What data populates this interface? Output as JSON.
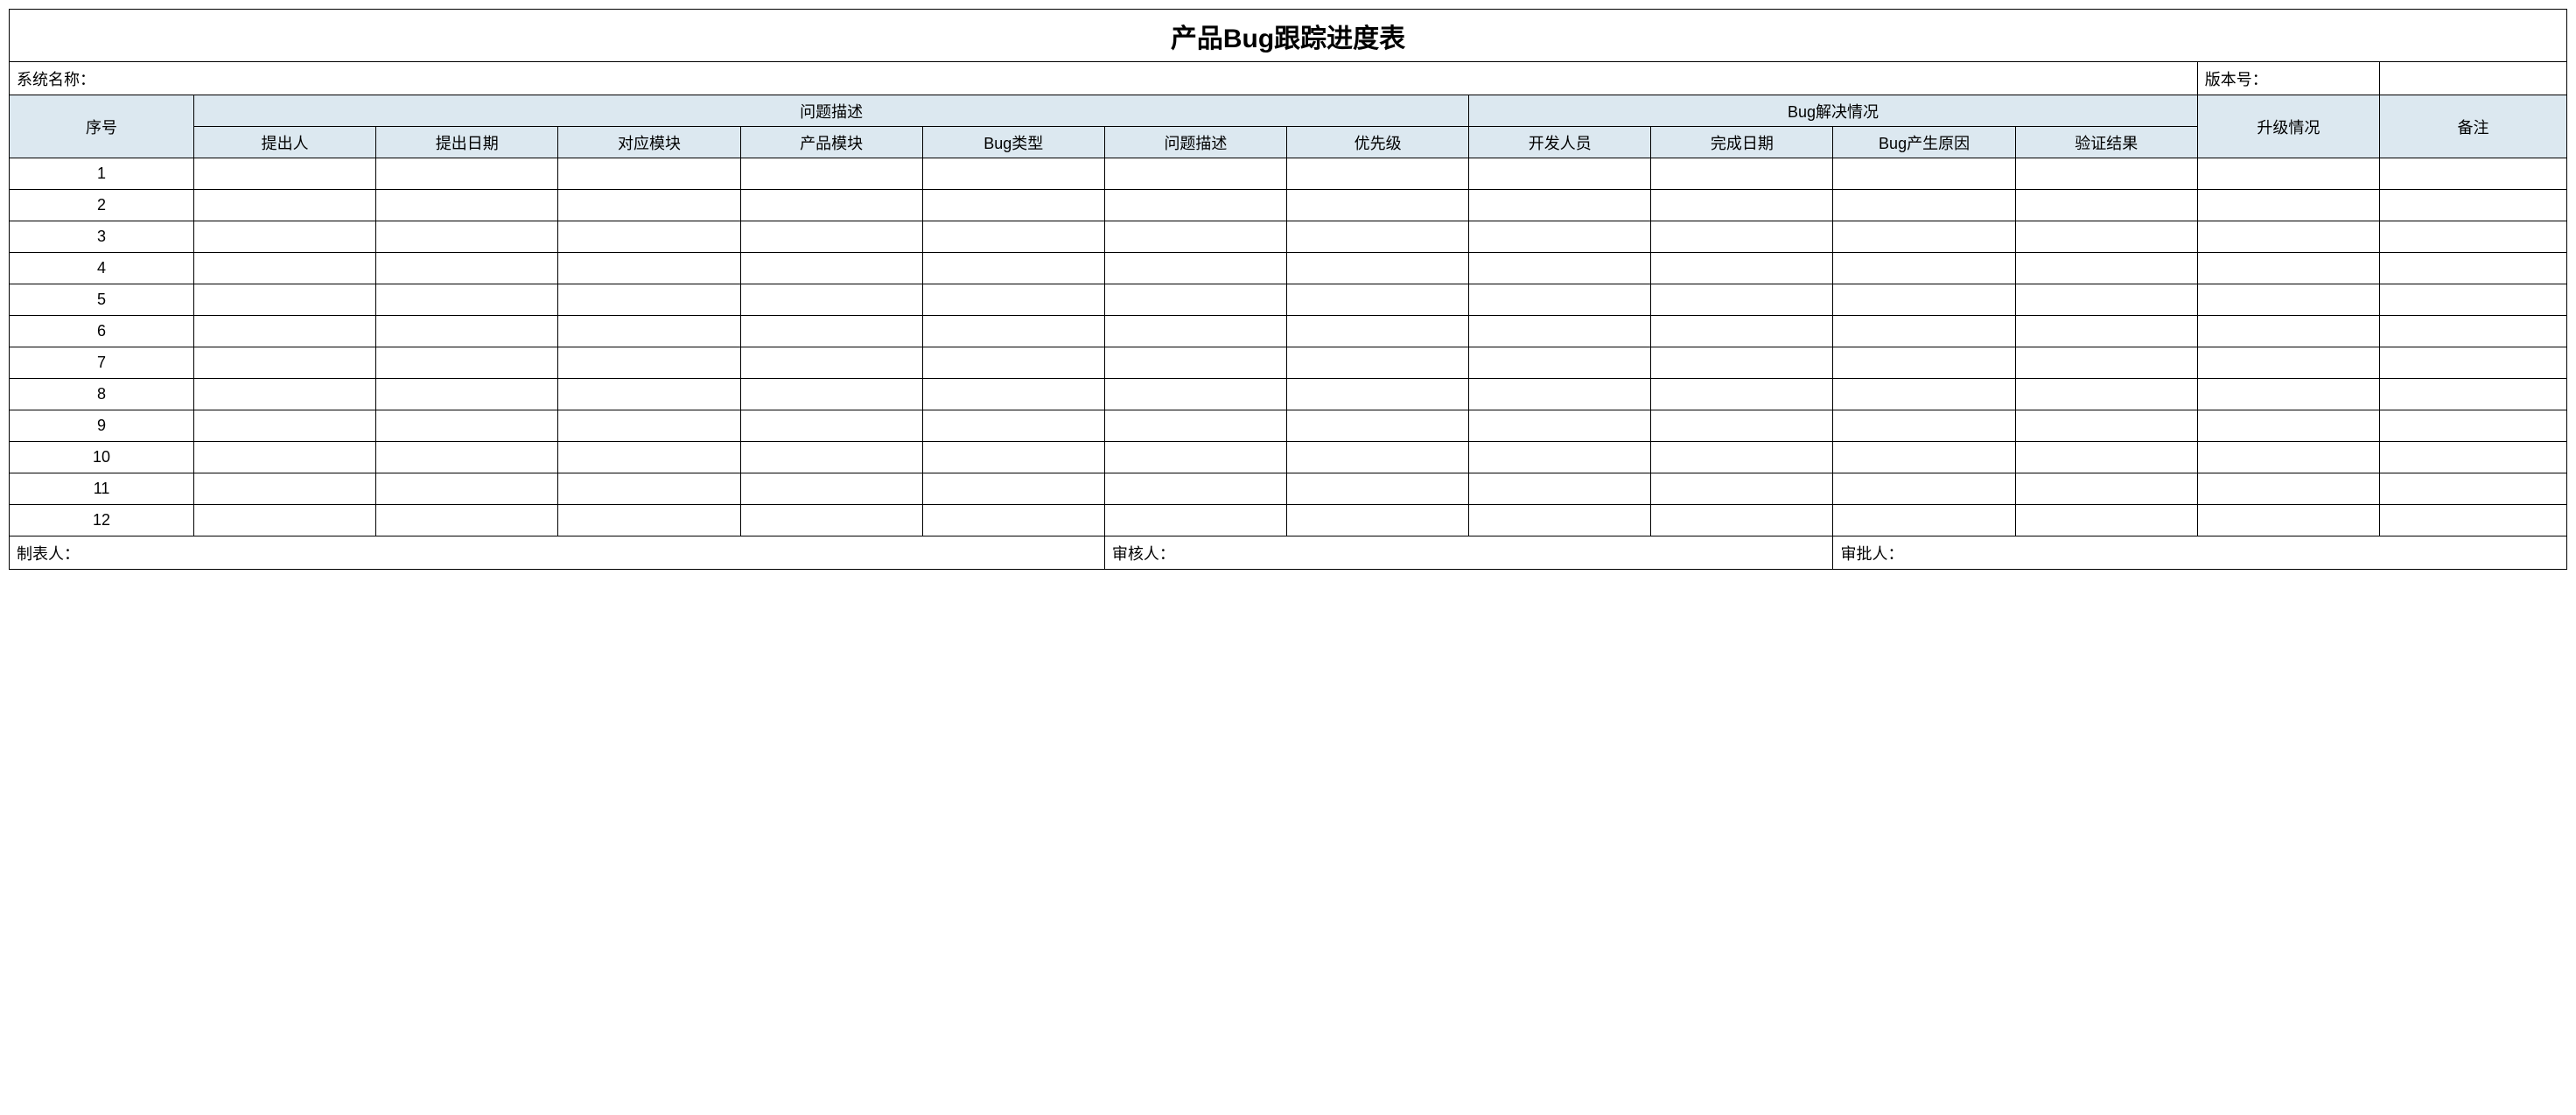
{
  "title": "产品Bug跟踪进度表",
  "info": {
    "system_name_label": "系统名称：",
    "system_name_value": "",
    "version_label": "版本号：",
    "version_value": ""
  },
  "headers": {
    "seq": "序号",
    "problem_group": "问题描述",
    "resolution_group": "Bug解决情况",
    "upgrade": "升级情况",
    "remark": "备注",
    "sub": {
      "submitter": "提出人",
      "submit_date": "提出日期",
      "corresp_module": "对应模块",
      "product_module": "产品模块",
      "bug_type": "Bug类型",
      "problem_desc": "问题描述",
      "priority": "优先级",
      "developer": "开发人员",
      "complete_date": "完成日期",
      "bug_cause": "Bug产生原因",
      "verify_result": "验证结果"
    }
  },
  "rows": [
    {
      "seq": "1"
    },
    {
      "seq": "2"
    },
    {
      "seq": "3"
    },
    {
      "seq": "4"
    },
    {
      "seq": "5"
    },
    {
      "seq": "6"
    },
    {
      "seq": "7"
    },
    {
      "seq": "8"
    },
    {
      "seq": "9"
    },
    {
      "seq": "10"
    },
    {
      "seq": "11"
    },
    {
      "seq": "12"
    }
  ],
  "footer": {
    "preparer_label": "制表人：",
    "preparer_value": "",
    "reviewer_label": "审核人：",
    "reviewer_value": "",
    "approver_label": "审批人：",
    "approver_value": ""
  }
}
